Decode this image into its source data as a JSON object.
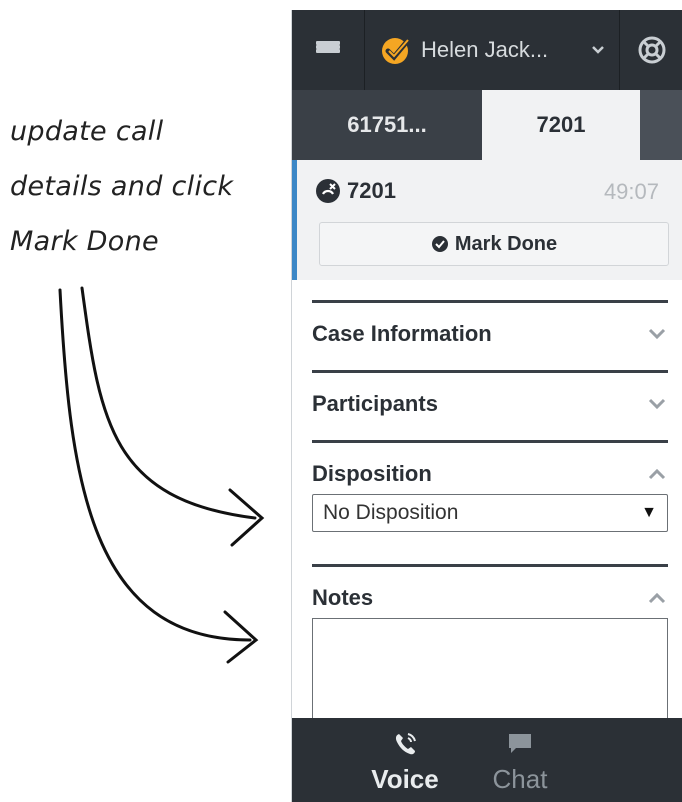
{
  "annotation": {
    "lines": [
      "update call",
      "details and click",
      "Mark Done"
    ]
  },
  "topbar": {
    "menu_icon": "hamburger-menu-icon",
    "agent_name": "Helen Jack...",
    "agent_icon": "agent-status-icon",
    "dropdown_icon": "chevron-down-icon",
    "support_icon": "lifebuoy-icon"
  },
  "tabs": [
    {
      "label": "61751..."
    },
    {
      "label": "7201"
    }
  ],
  "interaction": {
    "id": "7201",
    "timer": "49:07",
    "status_icon": "call-ended-icon",
    "mark_done_label": "Mark Done"
  },
  "sections": {
    "case_information": "Case Information",
    "participants": "Participants",
    "disposition": "Disposition",
    "notes": "Notes"
  },
  "disposition": {
    "selected": "No Disposition"
  },
  "bottom_nav": {
    "voice": "Voice",
    "chat": "Chat"
  },
  "colors": {
    "dark_bar": "#2b3036",
    "accent": "#3c87c6",
    "agent_icon": "#f5a623"
  }
}
